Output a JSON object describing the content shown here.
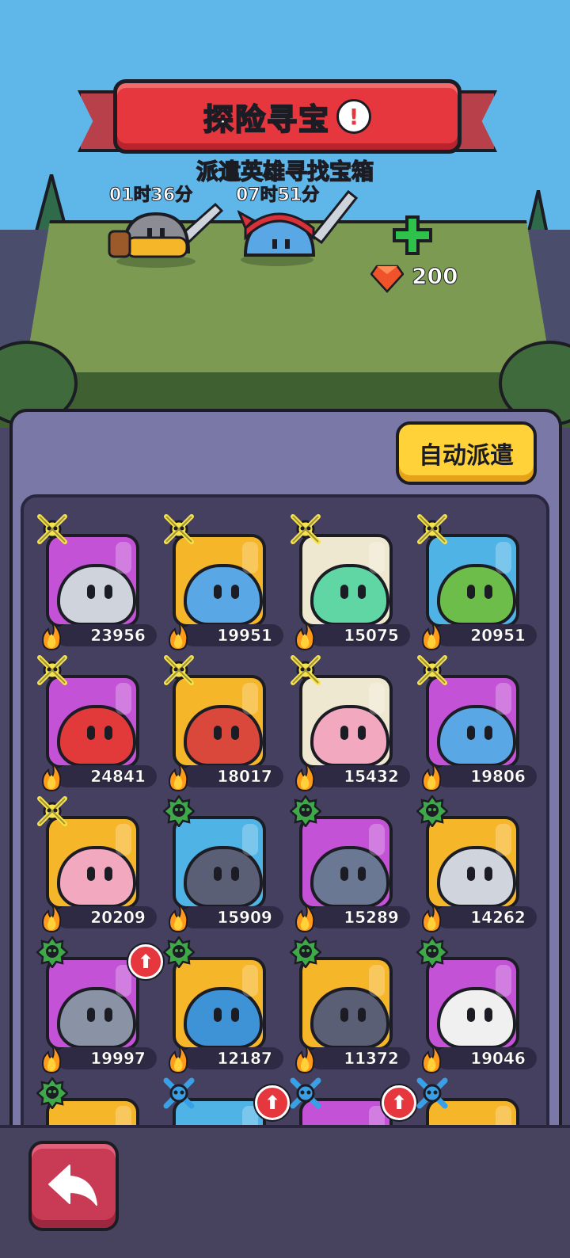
{
  "header": {
    "title": "探险寻宝",
    "title_icon": "alert-icon",
    "subtitle": "派遣英雄寻找宝箱"
  },
  "expedition": {
    "slots": [
      {
        "hero": "knight-hero",
        "timer": "01时36分"
      },
      {
        "hero": "viking-hero",
        "timer": "07时51分"
      }
    ],
    "add_slot": {
      "icon": "plus-icon",
      "gem_icon": "gem-icon",
      "cost": "200"
    }
  },
  "panel": {
    "auto_dispatch_label": "自动派遣"
  },
  "heroes": [
    {
      "power": "23956",
      "bg": "#c352d6",
      "body": "#cfd3dc",
      "badge": "skull-bones",
      "upgrade": false
    },
    {
      "power": "19951",
      "bg": "#f6b62a",
      "body": "#5aa7e6",
      "badge": "skull-bones",
      "upgrade": false
    },
    {
      "power": "15075",
      "bg": "#efe8d0",
      "body": "#5fd6a4",
      "badge": "skull-bones",
      "upgrade": false
    },
    {
      "power": "20951",
      "bg": "#4fb3e6",
      "body": "#6dbd4a",
      "badge": "skull-bones",
      "upgrade": false
    },
    {
      "power": "24841",
      "bg": "#c352d6",
      "body": "#e23a3a",
      "badge": "skull-bones",
      "upgrade": false
    },
    {
      "power": "18017",
      "bg": "#f6b62a",
      "body": "#d9483a",
      "badge": "skull-bones",
      "upgrade": false
    },
    {
      "power": "15432",
      "bg": "#efe8d0",
      "body": "#f2a8bf",
      "badge": "skull-bones",
      "upgrade": false
    },
    {
      "power": "19806",
      "bg": "#c352d6",
      "body": "#5aa7e6",
      "badge": "skull-bones",
      "upgrade": false
    },
    {
      "power": "20209",
      "bg": "#f6b62a",
      "body": "#f2a8bf",
      "badge": "skull-bones",
      "upgrade": false
    },
    {
      "power": "15909",
      "bg": "#4fb3e6",
      "body": "#5b5f76",
      "badge": "green-skull",
      "upgrade": false
    },
    {
      "power": "15289",
      "bg": "#c352d6",
      "body": "#6a7894",
      "badge": "green-skull",
      "upgrade": false
    },
    {
      "power": "14262",
      "bg": "#f6b62a",
      "body": "#d0d4dc",
      "badge": "green-skull",
      "upgrade": false
    },
    {
      "power": "19997",
      "bg": "#c352d6",
      "body": "#8a93a6",
      "badge": "green-skull",
      "upgrade": true
    },
    {
      "power": "12187",
      "bg": "#f6b62a",
      "body": "#3d93d6",
      "badge": "green-skull",
      "upgrade": false
    },
    {
      "power": "11372",
      "bg": "#f6b62a",
      "body": "#5b5f76",
      "badge": "green-skull",
      "upgrade": false
    },
    {
      "power": "19046",
      "bg": "#c352d6",
      "body": "#f0f0f0",
      "badge": "green-skull",
      "upgrade": false
    },
    {
      "power": "",
      "bg": "#f6b62a",
      "body": "#7a3fd0",
      "badge": "green-skull",
      "upgrade": false
    },
    {
      "power": "",
      "bg": "#4fb3e6",
      "body": "#d0d4dc",
      "badge": "blue-skull",
      "upgrade": true
    },
    {
      "power": "",
      "bg": "#c352d6",
      "body": "#5fb6c6",
      "badge": "blue-skull",
      "upgrade": true
    },
    {
      "power": "",
      "bg": "#f6b62a",
      "body": "#e26a3a",
      "badge": "blue-skull",
      "upgrade": false
    }
  ],
  "footer": {
    "back_icon": "back-arrow-icon"
  },
  "colors": {
    "accent_red": "#e6363e",
    "button_yellow": "#ffd23a",
    "panel": "#7a78a6",
    "grid": "#454060"
  }
}
